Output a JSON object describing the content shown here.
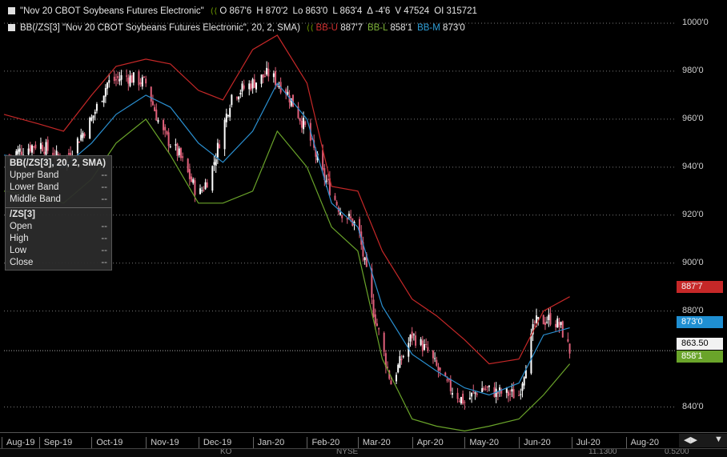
{
  "legend": {
    "main": {
      "title": "\"Nov 20 CBOT Soybeans Futures Electronic\"",
      "nav": "⟨ ⟨",
      "ohlc": [
        "O 867'6",
        "H 870'2",
        "Lo 863'0",
        "L 863'4",
        "Δ -4'6",
        "V 47524",
        "OI 315721"
      ]
    },
    "bb": {
      "title": "BB(/ZS[3] \"Nov 20 CBOT Soybeans Futures Electronic\", 20, 2, SMA)",
      "nav": "⟨ ⟨",
      "upper_label": "BB-U",
      "upper_value": "887'7",
      "lower_label": "BB-L",
      "lower_value": "858'1",
      "middle_label": "BB-M",
      "middle_value": "873'0"
    }
  },
  "data_window": {
    "title": "BB(/ZS[3], 20, 2, SMA)",
    "rows": [
      {
        "label": "Upper Band",
        "value": "--"
      },
      {
        "label": "Lower Band",
        "value": "--"
      },
      {
        "label": "Middle Band",
        "value": "--"
      }
    ],
    "symbol": "/ZS[3]",
    "price_rows": [
      {
        "label": "Open",
        "value": "--"
      },
      {
        "label": "High",
        "value": "--"
      },
      {
        "label": "Low",
        "value": "--"
      },
      {
        "label": "Close",
        "value": "--"
      }
    ]
  },
  "price_tags": {
    "upper": "887'7",
    "middle": "873'0",
    "last": "863.50",
    "lower": "858'1"
  },
  "scroll_controls": {
    "left": "◀▶",
    "right": "▼"
  },
  "bottom_strip": [
    "KO",
    "NYSE",
    "11.1300",
    "0.5200"
  ],
  "colors": {
    "background": "#000000",
    "up_candle": "#ffffff",
    "down_candle": "#e0607a",
    "upper_band": "#c62828",
    "lower_band": "#6aa42a",
    "middle_band": "#2a8fd0",
    "grid": "#7a7a7a"
  },
  "chart_data": {
    "type": "candlestick",
    "title": "\"Nov 20 CBOT Soybeans Futures Electronic\"",
    "y_tick_labels": [
      "1000'0",
      "980'0",
      "960'0",
      "940'0",
      "920'0",
      "900'0",
      "880'0",
      "840'0"
    ],
    "y_ticks": [
      1000,
      980,
      960,
      940,
      920,
      900,
      880,
      840
    ],
    "ylim": [
      829.5,
      1005
    ],
    "x_tick_labels": [
      "Aug-19",
      "Sep-19",
      "Oct-19",
      "Nov-19",
      "Dec-19",
      "Jan-20",
      "Feb-20",
      "Mar-20",
      "Apr-20",
      "May-20",
      "Jun-20",
      "Jul-20",
      "Aug-20"
    ],
    "xlim": [
      "2019-08-12",
      "2020-08-30"
    ],
    "grid": true,
    "close_series": {
      "dates": [
        "2019-08-15",
        "2019-09-01",
        "2019-09-15",
        "2019-10-01",
        "2019-10-10",
        "2019-10-20",
        "2019-11-01",
        "2019-11-10",
        "2019-11-20",
        "2019-12-01",
        "2019-12-08",
        "2019-12-20",
        "2020-01-01",
        "2020-01-10",
        "2020-01-20",
        "2020-02-01",
        "2020-02-10",
        "2020-02-20",
        "2020-03-01",
        "2020-03-10",
        "2020-03-20",
        "2020-04-01",
        "2020-04-10",
        "2020-04-20",
        "2020-05-01",
        "2020-05-10",
        "2020-05-20",
        "2020-06-01",
        "2020-06-10",
        "2020-06-20",
        "2020-06-25",
        "2020-06-30"
      ],
      "values": [
        945,
        950,
        942,
        960,
        975,
        978,
        975,
        955,
        945,
        928,
        937,
        970,
        975,
        979,
        972,
        955,
        937,
        922,
        915,
        880,
        850,
        870,
        863,
        850,
        842,
        848,
        846,
        845,
        875,
        877,
        873,
        863.5
      ]
    },
    "bollinger": {
      "period": 20,
      "stdev": 2,
      "type": "SMA",
      "dates": [
        "2019-08-12",
        "2019-09-01",
        "2019-09-15",
        "2019-10-01",
        "2019-10-15",
        "2019-11-01",
        "2019-11-15",
        "2019-12-01",
        "2019-12-15",
        "2020-01-01",
        "2020-01-15",
        "2020-02-01",
        "2020-02-15",
        "2020-03-01",
        "2020-03-15",
        "2020-04-01",
        "2020-04-15",
        "2020-05-01",
        "2020-05-15",
        "2020-06-01",
        "2020-06-15",
        "2020-06-30"
      ],
      "upper": [
        962,
        958,
        955,
        970,
        982,
        985,
        983,
        972,
        968,
        989,
        995,
        975,
        932,
        930,
        905,
        885,
        878,
        868,
        858,
        860,
        880,
        886
      ],
      "middle": [
        945,
        943,
        940,
        950,
        962,
        970,
        965,
        950,
        942,
        955,
        975,
        960,
        925,
        915,
        882,
        862,
        855,
        848,
        845,
        850,
        870,
        873
      ],
      "lower": [
        930,
        928,
        925,
        935,
        950,
        960,
        945,
        925,
        925,
        930,
        955,
        940,
        915,
        905,
        860,
        835,
        832,
        830,
        832,
        835,
        845,
        858
      ]
    },
    "last_price": 863.5
  }
}
